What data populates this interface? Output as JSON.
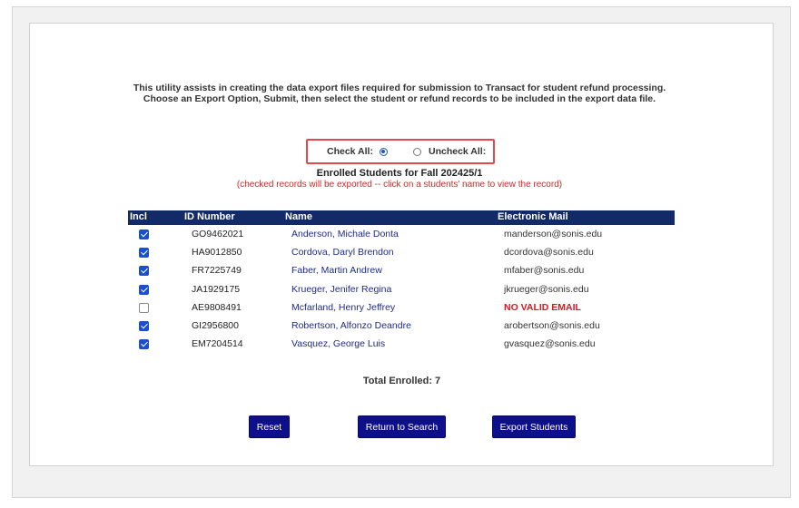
{
  "intro": {
    "line1": "This utility assists in creating the data export files required for submission to Transact for student refund processing.",
    "line2": "Choose an Export Option, Submit, then select the student or refund records to be included in the export data file."
  },
  "check_controls": {
    "check_all_label": "Check All:",
    "uncheck_all_label": "Uncheck All:",
    "selected": "check_all"
  },
  "section": {
    "heading": "Enrolled Students for Fall 202425/1",
    "note": "(checked records will be exported -- click on a students' name to view the record)"
  },
  "table": {
    "headers": {
      "incl": "Incl",
      "id": "ID Number",
      "name": "Name",
      "email": "Electronic Mail"
    },
    "rows": [
      {
        "checked": true,
        "id": "GO9462021",
        "name": "Anderson, Michale Donta",
        "email": "manderson@sonis.edu"
      },
      {
        "checked": true,
        "id": "HA9012850",
        "name": "Cordova, Daryl Brendon",
        "email": "dcordova@sonis.edu"
      },
      {
        "checked": true,
        "id": "FR7225749",
        "name": "Faber, Martin Andrew",
        "email": "mfaber@sonis.edu"
      },
      {
        "checked": true,
        "id": "JA1929175",
        "name": "Krueger, Jenifer Regina",
        "email": "jkrueger@sonis.edu"
      },
      {
        "checked": false,
        "id": "AE9808491",
        "name": "Mcfarland, Henry Jeffrey",
        "email": "NO VALID EMAIL"
      },
      {
        "checked": true,
        "id": "GI2956800",
        "name": "Robertson, Alfonzo Deandre",
        "email": "arobertson@sonis.edu"
      },
      {
        "checked": true,
        "id": "EM7204514",
        "name": "Vasquez, George Luis",
        "email": "gvasquez@sonis.edu"
      }
    ]
  },
  "total_label": "Total Enrolled: 7",
  "buttons": {
    "reset": "Reset",
    "return_to_search": "Return to Search",
    "export_students": "Export Students"
  },
  "colors": {
    "header_bg": "#132a68",
    "button_bg": "#0e0f8a",
    "highlight_border": "#e2494a",
    "warning_text": "#e0151d",
    "link_text": "#1f2a8a"
  }
}
